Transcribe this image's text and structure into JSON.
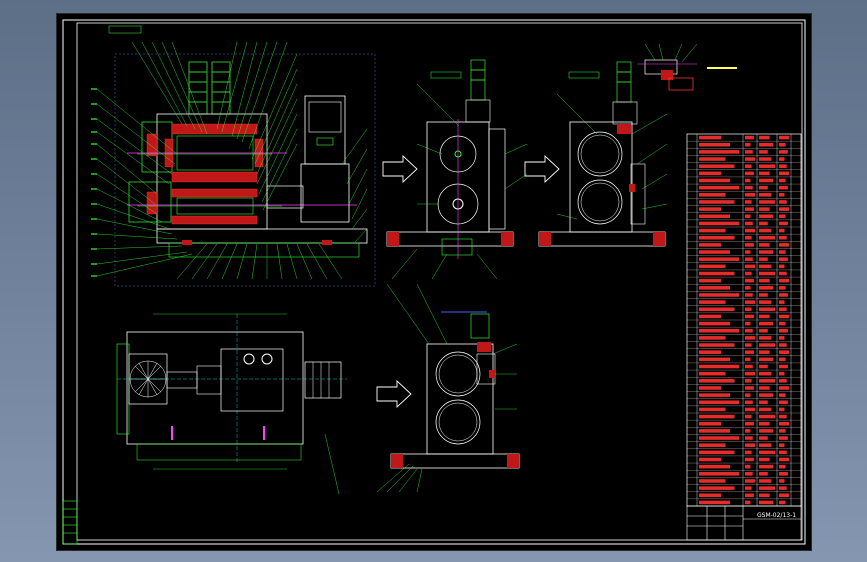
{
  "sheet": {
    "drawing_code": "GSM-02/13-1",
    "colors": {
      "frame": "#ffffff",
      "outline": "#ffffff",
      "leader": "#33ff33",
      "motor": "#33cc33",
      "cutting": "#ff3030",
      "axis": "#ff40ff",
      "center": "#00ffff",
      "dims": "#40a0ff",
      "text": "#ffff60"
    },
    "views": [
      {
        "name": "main-section-view",
        "label": ""
      },
      {
        "name": "side-view-a",
        "label": ""
      },
      {
        "name": "side-view-b",
        "label": ""
      },
      {
        "name": "side-view-c",
        "label": ""
      },
      {
        "name": "top-view",
        "label": ""
      },
      {
        "name": "detail-view",
        "label": ""
      }
    ],
    "parts_table_rows": 52
  }
}
